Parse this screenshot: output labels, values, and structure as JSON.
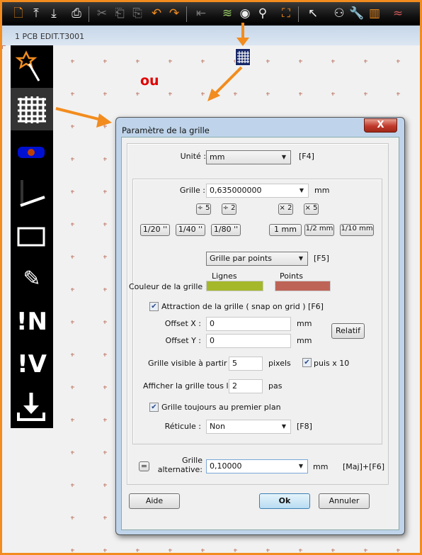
{
  "toolbar": {
    "icons": [
      "new-file-icon",
      "import-icon",
      "export-icon",
      "print-icon",
      "cut-icon",
      "paste-in-icon",
      "paste-out-icon",
      "undo-icon",
      "redo-icon",
      "exit-icon",
      "layers-icon",
      "eye-icon",
      "zoom-icon",
      "fit-icon",
      "pointer-icon",
      "binoculars-icon",
      "wrench-icon",
      "component-icon",
      "track-icon"
    ]
  },
  "tab": {
    "label": "1 PCB EDIT.T3001"
  },
  "annotation": {
    "or_label": "ou",
    "arrow_color": "#f28c1e",
    "label_color": "#e00000"
  },
  "sidebar": {
    "items": [
      {
        "icon": "magic-wand-icon"
      },
      {
        "icon": "grid-icon",
        "active": true
      },
      {
        "icon": "pad-icon"
      },
      {
        "icon": "track-icon"
      },
      {
        "icon": "rectangle-icon"
      },
      {
        "icon": "pencil-icon"
      },
      {
        "label": "!N"
      },
      {
        "label": "!V"
      },
      {
        "icon": "download-icon"
      }
    ]
  },
  "dialog": {
    "title": "Paramètre de la grille",
    "close": "X",
    "unit_label": "Unité :",
    "unit_value": "mm",
    "unit_key": "[F4]",
    "grid_label": "Grille :",
    "grid_value": "0,635000000",
    "grid_unit": "mm",
    "div5": "÷ 5",
    "div2": "÷ 2",
    "mul2": "× 2",
    "mul5": "× 5",
    "presets": [
      "1/20 ''",
      "1/40 ''",
      "1/80 ''",
      "1 mm",
      "1/2 mm",
      "1/10 mm"
    ],
    "grid_type": "Grille par points",
    "grid_type_key": "[F5]",
    "color_label": "Couleur de la grille :",
    "lines_label": "Lignes",
    "points_label": "Points",
    "lines_color": "#a4b82a",
    "points_color": "#be6456",
    "snap_label": "Attraction de la grille ( snap on grid )  [F6]",
    "snap_checked": true,
    "offset_x_label": "Offset X :",
    "offset_x": "0",
    "offset_y_label": "Offset Y :",
    "offset_y": "0",
    "offset_unit": "mm",
    "relative": "Relatif",
    "visible_label": "Grille visible à partir de",
    "visible_value": "5",
    "visible_unit": "pixels",
    "times10_label": "puis x 10",
    "times10_checked": true,
    "show_every_label": "Afficher la grille tous les",
    "show_every_value": "2",
    "show_every_unit": "pas",
    "foreground_label": "Grille toujours au premier plan",
    "foreground_checked": true,
    "reticle_label": "Réticule :",
    "reticle_value": "Non",
    "reticle_key": "[F8]",
    "equal": "=",
    "alt_label_1": "Grille",
    "alt_label_2": "alternative:",
    "alt_value": "0,10000",
    "alt_unit": "mm",
    "alt_key": "[Maj]+[F6]",
    "help": "Aide",
    "ok": "Ok",
    "cancel": "Annuler"
  }
}
